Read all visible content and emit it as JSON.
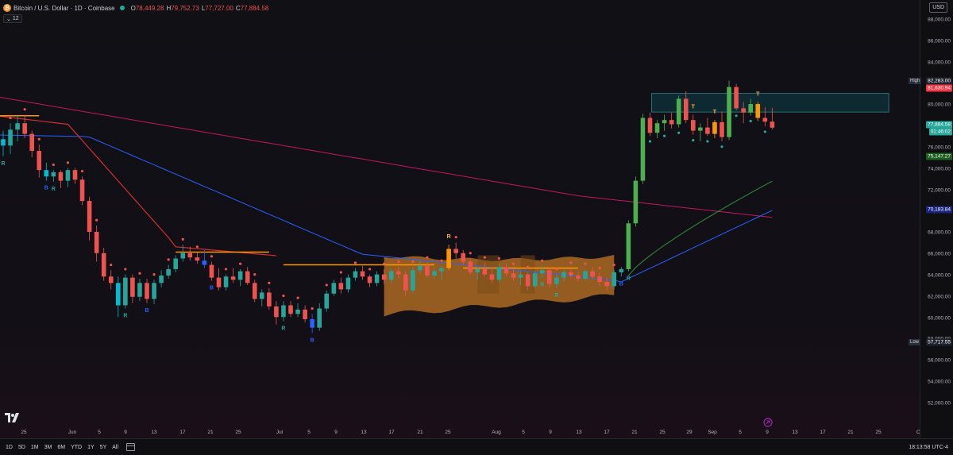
{
  "header": {
    "symbol_icon": "bitcoin-icon",
    "title": "Bitcoin / U.S. Dollar · 1D · Coinbase",
    "ohlc": {
      "o_label": "O",
      "o": "78,449.28",
      "h_label": "H",
      "h": "79,752.73",
      "l_label": "L",
      "l": "77,727.00",
      "c_label": "C",
      "c": "77,884.58"
    },
    "indicator_count": "12",
    "currency": "USD"
  },
  "price_axis": {
    "ticks": [
      "88,000.00",
      "86,000.00",
      "84,000.00",
      "82,000.00",
      "80,000.00",
      "78,000.00",
      "76,000.00",
      "74,000.00",
      "72,000.00",
      "70,000.00",
      "68,000.00",
      "66,000.00",
      "64,000.00",
      "62,000.00",
      "60,000.00",
      "58,000.00",
      "56,000.00",
      "54,000.00",
      "52,000.00"
    ],
    "high_tag": "High",
    "high_value": "82,283.00",
    "low_tag": "Low",
    "low_value": "57,717.55",
    "labels": {
      "red_level": "81,630.94",
      "last_price": "77,884.58",
      "countdown": "01:46:02",
      "green_ma": "75,147.27",
      "blue_ma": "70,183.84"
    }
  },
  "time_axis": {
    "ticks": [
      "25",
      "Jun",
      "5",
      "9",
      "13",
      "17",
      "21",
      "25",
      "Jul",
      "5",
      "9",
      "13",
      "17",
      "21",
      "25",
      "Aug",
      "5",
      "9",
      "13",
      "17",
      "21",
      "25",
      "29",
      "Sep",
      "5",
      "9",
      "13",
      "17",
      "21",
      "25",
      "Oc"
    ]
  },
  "bottom_bar": {
    "ranges": [
      "1D",
      "5D",
      "1M",
      "3M",
      "6M",
      "YTD",
      "1Y",
      "5Y",
      "All"
    ],
    "clock": "18:13:58 UTC-4"
  },
  "chart_data": {
    "type": "candlestick",
    "ylim": [
      50500,
      89500
    ],
    "colors": {
      "up": "#26a69a",
      "down": "#ef5350",
      "up_alt": "#4caf50",
      "blue_candle": "#2962ff",
      "cyan_candle": "#00bcd4",
      "orange_candle": "#ff9800",
      "ma_red": "#d32f2f",
      "ma_blue": "#2962ff",
      "ma_magenta": "#c2185b",
      "ma_green": "#2e7d32",
      "box_fill": "#c87a26",
      "resistance": "#4dd0e1"
    },
    "candles": [
      [
        76800,
        77600,
        75200,
        76200
      ],
      [
        76200,
        78300,
        75400,
        77700
      ],
      [
        77700,
        79000,
        76600,
        78300
      ],
      [
        78300,
        79100,
        76900,
        77300
      ],
      [
        77300,
        77600,
        75100,
        75700
      ],
      [
        75700,
        76300,
        73200,
        73900
      ],
      [
        73900,
        74600,
        72900,
        73300
      ],
      [
        73300,
        73900,
        72800,
        73700
      ],
      [
        73700,
        73900,
        72200,
        72900
      ],
      [
        72900,
        74100,
        72300,
        73900
      ],
      [
        73900,
        74100,
        72600,
        73000
      ],
      [
        73000,
        73300,
        70600,
        71000
      ],
      [
        71000,
        71400,
        67300,
        68100
      ],
      [
        68100,
        68700,
        65300,
        66100
      ],
      [
        66100,
        66600,
        63500,
        63900
      ],
      [
        63900,
        64500,
        62700,
        63300
      ],
      [
        63300,
        63900,
        60100,
        61200
      ],
      [
        61200,
        64100,
        60900,
        63800
      ],
      [
        63800,
        64100,
        61400,
        62000
      ],
      [
        62000,
        63700,
        61600,
        63300
      ],
      [
        63300,
        63700,
        61400,
        61800
      ],
      [
        61800,
        63600,
        61300,
        63300
      ],
      [
        63300,
        64500,
        62900,
        64000
      ],
      [
        64000,
        65000,
        63700,
        64600
      ],
      [
        64600,
        65900,
        64300,
        65600
      ],
      [
        65600,
        66900,
        65300,
        66100
      ],
      [
        66100,
        66700,
        65400,
        65700
      ],
      [
        65700,
        66200,
        65100,
        65400
      ],
      [
        65400,
        66400,
        64700,
        65000
      ],
      [
        65000,
        65300,
        63500,
        63800
      ],
      [
        63800,
        64700,
        62600,
        62900
      ],
      [
        62900,
        64100,
        62600,
        63900
      ],
      [
        63900,
        64700,
        63300,
        63600
      ],
      [
        63600,
        64600,
        63000,
        64400
      ],
      [
        64400,
        64800,
        63100,
        63300
      ],
      [
        63300,
        63600,
        61500,
        61800
      ],
      [
        61800,
        62700,
        61100,
        62400
      ],
      [
        62400,
        62800,
        60800,
        61100
      ],
      [
        61100,
        61600,
        59400,
        60100
      ],
      [
        60100,
        61600,
        59700,
        61200
      ],
      [
        61200,
        61600,
        60100,
        60400
      ],
      [
        60400,
        61400,
        60100,
        60800
      ],
      [
        60800,
        61200,
        59600,
        59900
      ],
      [
        59900,
        60400,
        58600,
        59100
      ],
      [
        59100,
        61400,
        58800,
        60900
      ],
      [
        60900,
        62600,
        60600,
        62300
      ],
      [
        62300,
        63600,
        62100,
        63300
      ],
      [
        63300,
        63800,
        62300,
        62700
      ],
      [
        62700,
        64100,
        62400,
        63800
      ],
      [
        63800,
        64700,
        63500,
        64400
      ],
      [
        64400,
        64900,
        63600,
        63900
      ],
      [
        63900,
        64100,
        62900,
        63300
      ],
      [
        63300,
        64400,
        63000,
        64100
      ],
      [
        64100,
        64600,
        63200,
        63600
      ],
      [
        63600,
        64600,
        63300,
        64400
      ],
      [
        64400,
        64800,
        63700,
        64100
      ],
      [
        64100,
        64400,
        62100,
        62600
      ],
      [
        62600,
        64800,
        62300,
        64500
      ],
      [
        64500,
        65400,
        64200,
        64900
      ],
      [
        64900,
        65200,
        63800,
        64000
      ],
      [
        64000,
        64700,
        63700,
        64400
      ],
      [
        64400,
        64900,
        63600,
        64700
      ],
      [
        64700,
        66900,
        64500,
        66500
      ],
      [
        66500,
        67100,
        65600,
        66100
      ],
      [
        66100,
        66400,
        65000,
        65300
      ],
      [
        65300,
        65600,
        64100,
        64300
      ],
      [
        64300,
        64800,
        63600,
        64600
      ],
      [
        64600,
        65200,
        63900,
        64100
      ],
      [
        64100,
        64800,
        63300,
        63600
      ],
      [
        63600,
        65100,
        63400,
        64800
      ],
      [
        64800,
        65100,
        63900,
        64200
      ],
      [
        64200,
        64600,
        63500,
        63800
      ],
      [
        63800,
        64400,
        63100,
        64100
      ],
      [
        64100,
        64300,
        62600,
        63000
      ],
      [
        63000,
        64400,
        62800,
        64200
      ],
      [
        64200,
        64900,
        63800,
        64500
      ],
      [
        64500,
        64800,
        62900,
        63200
      ],
      [
        63200,
        64100,
        62800,
        63800
      ],
      [
        63800,
        64500,
        63400,
        64300
      ],
      [
        64300,
        64700,
        63800,
        64000
      ],
      [
        64000,
        64300,
        63400,
        63700
      ],
      [
        63700,
        64600,
        63500,
        64400
      ],
      [
        64400,
        64800,
        63700,
        63900
      ],
      [
        63900,
        64200,
        63100,
        63400
      ],
      [
        63400,
        63800,
        62600,
        63000
      ],
      [
        63000,
        64500,
        62700,
        64300
      ],
      [
        64300,
        64800,
        63900,
        64600
      ],
      [
        64600,
        69200,
        64400,
        68900
      ],
      [
        68900,
        73300,
        68600,
        72900
      ],
      [
        72900,
        79200,
        72600,
        78800
      ],
      [
        78800,
        79300,
        77100,
        77400
      ],
      [
        77400,
        78600,
        76900,
        78300
      ],
      [
        78300,
        79100,
        77600,
        78600
      ],
      [
        78600,
        79300,
        77800,
        78200
      ],
      [
        78200,
        80900,
        77900,
        80600
      ],
      [
        80600,
        81300,
        78300,
        78600
      ],
      [
        78600,
        79100,
        77200,
        77600
      ],
      [
        77600,
        78300,
        76600,
        77900
      ],
      [
        77900,
        78800,
        77100,
        77300
      ],
      [
        77300,
        78600,
        76900,
        78400
      ],
      [
        78400,
        79400,
        76600,
        77000
      ],
      [
        77000,
        82300,
        76700,
        81700
      ],
      [
        81700,
        82000,
        79500,
        79700
      ],
      [
        79700,
        80300,
        78300,
        79300
      ],
      [
        79300,
        80600,
        79000,
        80100
      ],
      [
        80100,
        80300,
        78500,
        78800
      ],
      [
        78800,
        79800,
        78000,
        78449
      ],
      [
        78449,
        79753,
        77727,
        77885
      ]
    ],
    "markers": [
      {
        "i": 0,
        "text": "R",
        "color": "#26a69a",
        "side": "below"
      },
      {
        "i": 6,
        "text": "B",
        "color": "#2962ff",
        "side": "below"
      },
      {
        "i": 7,
        "text": "R",
        "color": "#26a69a",
        "side": "below"
      },
      {
        "i": 17,
        "text": "R",
        "color": "#26a69a",
        "side": "below"
      },
      {
        "i": 20,
        "text": "B",
        "color": "#2962ff",
        "side": "below"
      },
      {
        "i": 29,
        "text": "B",
        "color": "#2962ff",
        "side": "below"
      },
      {
        "i": 39,
        "text": "R",
        "color": "#26a69a",
        "side": "below"
      },
      {
        "i": 43,
        "text": "B",
        "color": "#2962ff",
        "side": "below"
      },
      {
        "i": 62,
        "text": "R",
        "color": "#ffb74d",
        "side": "above"
      },
      {
        "i": 75,
        "text": "R",
        "color": "#26a69a",
        "side": "below"
      },
      {
        "i": 77,
        "text": "R",
        "color": "#26a69a",
        "side": "below"
      },
      {
        "i": 86,
        "text": "B",
        "color": "#2962ff",
        "side": "below"
      },
      {
        "i": 87,
        "text": "R",
        "color": "#26a69a",
        "side": "below"
      },
      {
        "i": 96,
        "text": "T",
        "color": "#ffb74d",
        "side": "above"
      },
      {
        "i": 99,
        "text": "T",
        "color": "#ffb74d",
        "side": "above"
      },
      {
        "i": 105,
        "text": "T",
        "color": "#ffb74d",
        "side": "above"
      }
    ]
  }
}
